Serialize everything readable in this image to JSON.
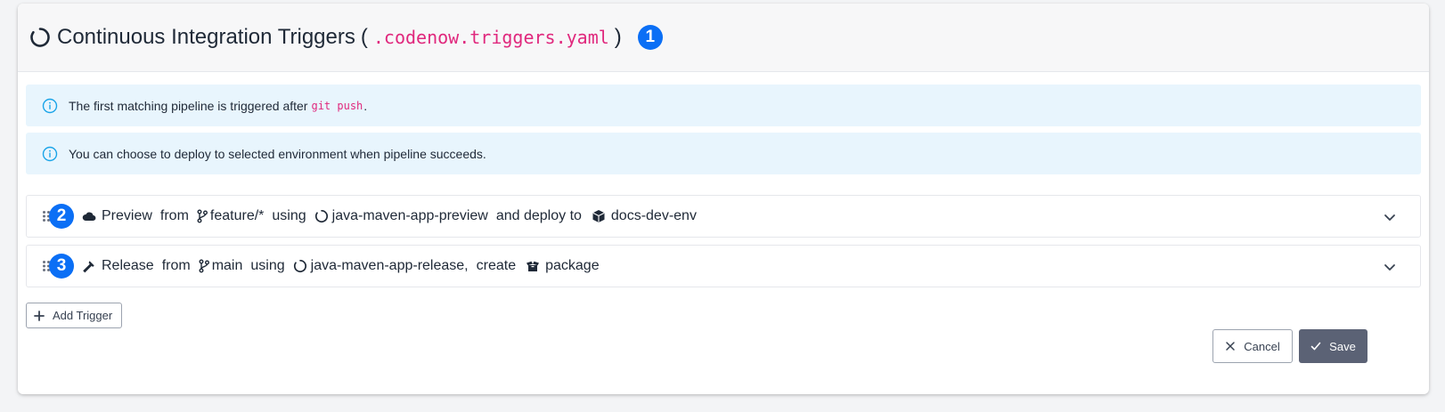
{
  "header": {
    "title": "Continuous Integration Triggers",
    "paren_open": "(",
    "file": ".codenow.triggers.yaml",
    "paren_close": ")",
    "badge": "1"
  },
  "alerts": [
    {
      "text_before": "The first matching pipeline is triggered after",
      "code": "git push",
      "text_after": "."
    },
    {
      "text": "You can choose to deploy to selected environment when pipeline succeeds."
    }
  ],
  "triggers": [
    {
      "badge": "2",
      "type_icon": "cloud-icon",
      "name": "Preview",
      "from_label": "from",
      "branch": "feature/*",
      "using_label": "using",
      "pipeline": "java-maven-app-preview",
      "action_label": "and deploy to",
      "target_icon": "cube-icon",
      "target": "docs-dev-env"
    },
    {
      "badge": "3",
      "type_icon": "hammer-icon",
      "name": "Release",
      "from_label": "from",
      "branch": "main",
      "using_label": "using",
      "pipeline": "java-maven-app-release,",
      "action_label": "create",
      "target_icon": "box-open-icon",
      "target": "package"
    }
  ],
  "buttons": {
    "add_trigger": "Add Trigger",
    "cancel": "Cancel",
    "save": "Save"
  },
  "colors": {
    "accent_badge": "#0b6ff5",
    "code_pink": "#e0287d",
    "alert_bg": "#e8f5fd",
    "save_bg": "#5b6275"
  }
}
